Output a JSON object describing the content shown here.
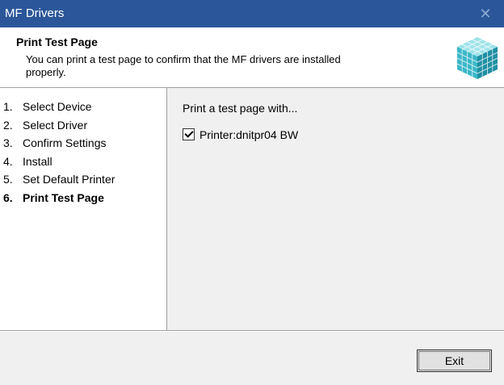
{
  "window": {
    "title": "MF Drivers",
    "close_glyph": "✕"
  },
  "header": {
    "title": "Print Test Page",
    "description": "You can print a test page to confirm that the MF drivers are installed properly.",
    "logo_icon": "cube-grid-icon"
  },
  "steps": [
    {
      "num": "1.",
      "label": "Select Device"
    },
    {
      "num": "2.",
      "label": "Select Driver"
    },
    {
      "num": "3.",
      "label": "Confirm Settings"
    },
    {
      "num": "4.",
      "label": "Install"
    },
    {
      "num": "5.",
      "label": "Set Default Printer"
    },
    {
      "num": "6.",
      "label": "Print Test Page"
    }
  ],
  "current_step": 6,
  "content": {
    "prompt": "Print a test page with...",
    "checkbox": {
      "label": "Printer:dnitpr04 BW",
      "checked": true
    }
  },
  "buttons": {
    "exit": "Exit"
  },
  "colors": {
    "titlebar": "#2b579a",
    "logo_main": "#3bb7c8"
  }
}
